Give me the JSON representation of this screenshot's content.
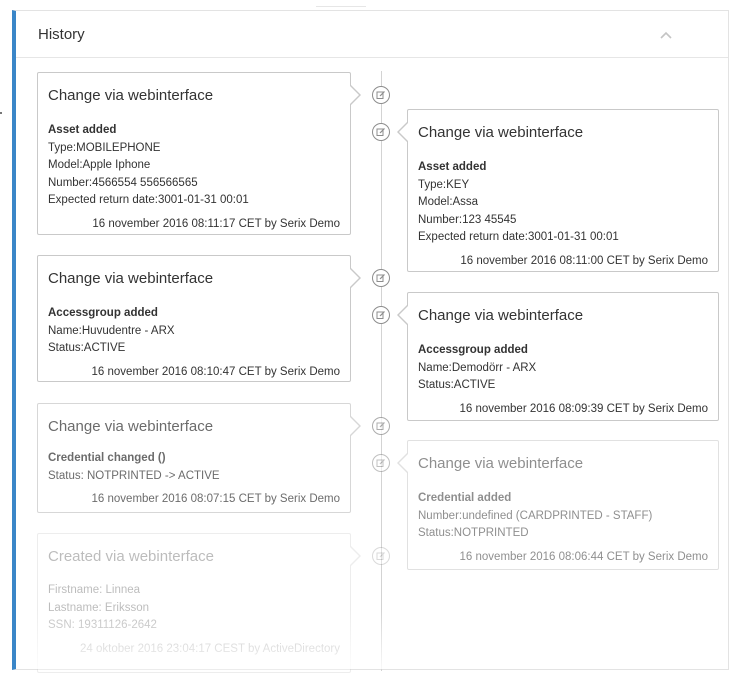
{
  "header": {
    "title": "History",
    "collapse_icon": "chevron-up-icon"
  },
  "entries": [
    {
      "side": "left",
      "title": "Change via webinterface",
      "heading": "Asset added",
      "lines": [
        "Type:MOBILEPHONE",
        "Model:Apple Iphone",
        "Number:4566554 556566565",
        "Expected return date:3001-01-31 00:01"
      ],
      "footer": "16 november 2016 08:11:17 CET by Serix Demo"
    },
    {
      "side": "right",
      "title": "Change via webinterface",
      "heading": "Asset added",
      "lines": [
        "Type:KEY",
        "Model:Assa",
        "Number:123 45545",
        "Expected return date:3001-01-31 00:01"
      ],
      "footer": "16 november 2016 08:11:00 CET by Serix Demo"
    },
    {
      "side": "left",
      "title": "Change via webinterface",
      "heading": "Accessgroup added",
      "lines": [
        "Name:Huvudentre - ARX",
        "Status:ACTIVE"
      ],
      "footer": "16 november 2016 08:10:47 CET by Serix Demo"
    },
    {
      "side": "right",
      "title": "Change via webinterface",
      "heading": "Accessgroup added",
      "lines": [
        "Name:Demodörr - ARX",
        "Status:ACTIVE"
      ],
      "footer": "16 november 2016 08:09:39 CET by Serix Demo"
    },
    {
      "side": "left",
      "title": "Change via webinterface",
      "heading": "Credential changed ()",
      "lines": [
        "Status: NOTPRINTED -> ACTIVE"
      ],
      "footer": "16 november 2016 08:07:15 CET by Serix Demo"
    },
    {
      "side": "right",
      "title": "Change via webinterface",
      "heading": "Credential added",
      "lines": [
        "Number:undefined (CARDPRINTED - STAFF)",
        "Status:NOTPRINTED"
      ],
      "footer": "16 november 2016 08:06:44 CET by Serix Demo"
    },
    {
      "side": "left",
      "title": "Created via webinterface",
      "heading": "",
      "lines": [
        "Firstname: Linnea",
        "Lastname: Eriksson",
        "SSN: 19311126-2642"
      ],
      "footer": "24 oktober 2016 23:04:17 CEST by ActiveDirectory"
    }
  ],
  "timeline_icon": "edit-icon",
  "colors": {
    "accent": "#3a86c8",
    "border": "#c9c9c9",
    "icon": "#8d8d8d"
  }
}
